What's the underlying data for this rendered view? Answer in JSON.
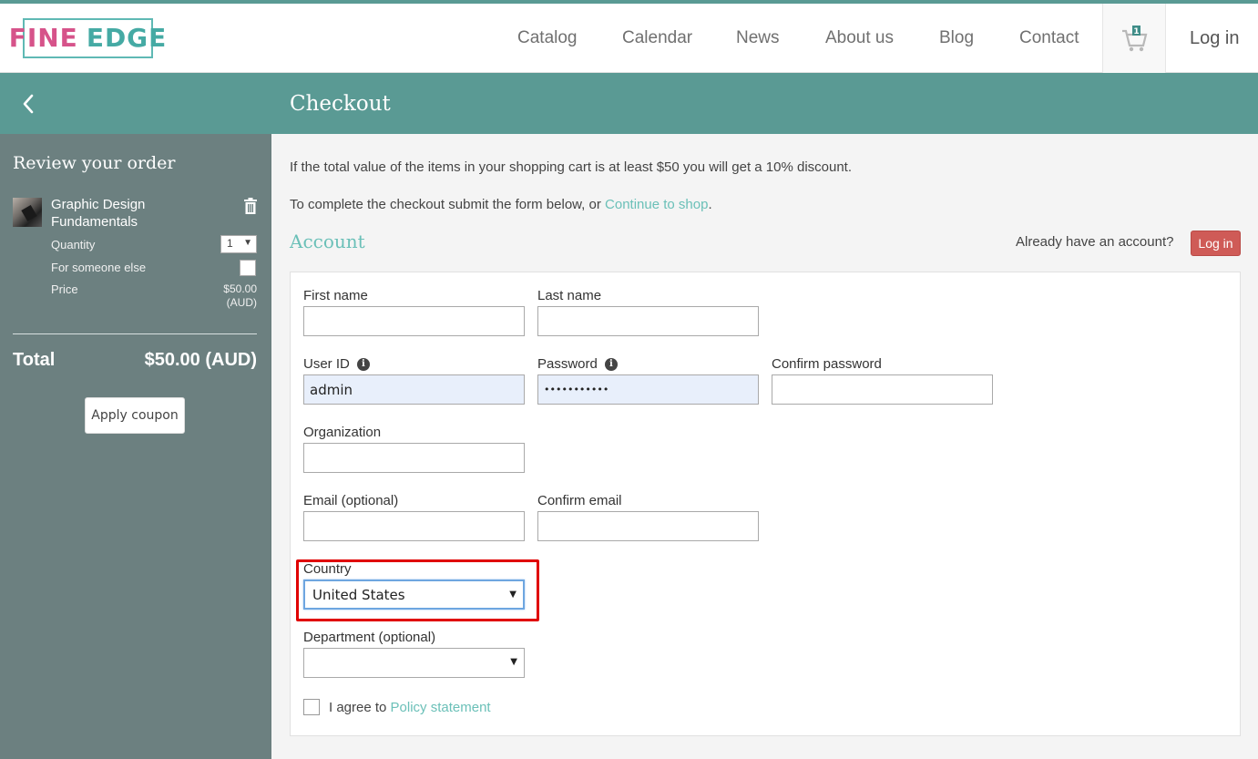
{
  "brand": {
    "word1": "FINE",
    "word2": "EDGE"
  },
  "nav": {
    "items": [
      "Catalog",
      "Calendar",
      "News",
      "About us",
      "Blog",
      "Contact"
    ],
    "login": "Log in",
    "cart_count": "1"
  },
  "page": {
    "title": "Checkout"
  },
  "sidebar": {
    "title": "Review your order",
    "item": {
      "name_line1": "Graphic Design",
      "name_line2": "Fundamentals",
      "quantity_label": "Quantity",
      "quantity_value": "1",
      "someone_else_label": "For someone else",
      "price_label": "Price",
      "price_amount": "$50.00",
      "price_currency": "(AUD)"
    },
    "total_label": "Total",
    "total_value": "$50.00 (AUD)",
    "coupon_button": "Apply coupon"
  },
  "main": {
    "discount_text": "If the total value of the items in your shopping cart is at least $50 you will get a 10% discount.",
    "complete_text": "To complete the checkout submit the form below, or ",
    "continue_link": "Continue to shop",
    "complete_end": ".",
    "account_heading": "Account",
    "have_account": "Already have an account?",
    "login_button": "Log in"
  },
  "form": {
    "first_name": {
      "label": "First name",
      "value": ""
    },
    "last_name": {
      "label": "Last name",
      "value": ""
    },
    "user_id": {
      "label": "User ID",
      "value": "admin"
    },
    "password": {
      "label": "Password",
      "value": "•••••••••••"
    },
    "confirm_password": {
      "label": "Confirm password",
      "value": ""
    },
    "organization": {
      "label": "Organization",
      "value": ""
    },
    "email": {
      "label": "Email (optional)",
      "value": ""
    },
    "confirm_email": {
      "label": "Confirm email",
      "value": ""
    },
    "country": {
      "label": "Country",
      "value": "United States"
    },
    "department": {
      "label": "Department (optional)",
      "value": ""
    },
    "agree_text": "I agree to ",
    "policy_link": "Policy statement"
  },
  "colors": {
    "teal": "#5a9a94",
    "sidebar": "#6c8080",
    "link": "#6bc0b8",
    "login_red": "#cf5b57",
    "highlight": "#e00000"
  }
}
